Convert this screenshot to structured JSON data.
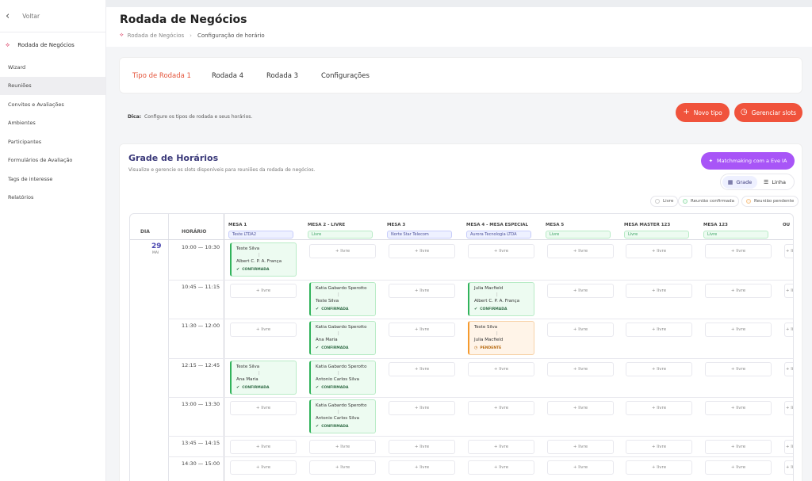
{
  "sidebar": {
    "back_label": "Voltar",
    "title": "Rodada de Negócios",
    "items": [
      {
        "label": "Wizard",
        "active": false
      },
      {
        "label": "Reuniões",
        "active": true
      },
      {
        "label": "Convites e Avaliações",
        "active": false
      },
      {
        "label": "Ambientes",
        "active": false
      },
      {
        "label": "Participantes",
        "active": false
      },
      {
        "label": "Formulários de Avaliação",
        "active": false
      },
      {
        "label": "Tags de interesse",
        "active": false
      },
      {
        "label": "Relatórios",
        "active": false
      }
    ]
  },
  "header": {
    "title": "Rodada de Negócios",
    "breadcrumb": [
      "Rodada de Negócios",
      "Configuração de horário"
    ]
  },
  "tabs": [
    {
      "label": "Tipo de Rodada 1",
      "active": true
    },
    {
      "label": "Rodada 4",
      "active": false
    },
    {
      "label": "Rodada 3",
      "active": false
    },
    {
      "label": "Configurações",
      "active": false
    }
  ],
  "tip": {
    "label": "Dica:",
    "text": "Configure os tipos de rodada e seus horários."
  },
  "actions": {
    "new_type": "Novo tipo",
    "manage_slots": "Gerenciar slots"
  },
  "grid": {
    "title": "Grade de Horários",
    "subtitle": "Visualize e gerencie os slots disponíveis para reuniões da rodada de negócios.",
    "ai_button": "Matchmaking com a Eve IA",
    "view_grid": "Grade",
    "view_list": "Linha",
    "legend": {
      "free": "Livre",
      "confirmed": "Reunião confirmada",
      "pending": "Reunião pendente"
    },
    "day_header": "DIA",
    "time_header": "HORÁRIO",
    "day": {
      "num": "29",
      "month": "MAI"
    },
    "free_label": "+ livre",
    "columns": [
      {
        "name": "MESA 1",
        "tag": "Teste LTDA2",
        "tag_style": "blue"
      },
      {
        "name": "MESA 2 - LIVRE",
        "tag": "Livre",
        "tag_style": "green"
      },
      {
        "name": "MESA 3",
        "tag": "Norte Star Telecom",
        "tag_style": "blue"
      },
      {
        "name": "MESA 4 - MESA ESPECIAL",
        "tag": "Aurora Tecnologia LTDA",
        "tag_style": "blue"
      },
      {
        "name": "MESA 5",
        "tag": "Livre",
        "tag_style": "green"
      },
      {
        "name": "MESA MASTER 123",
        "tag": "Livre",
        "tag_style": "green"
      },
      {
        "name": "MESA 123",
        "tag": "Livre",
        "tag_style": "green"
      },
      {
        "name": "OU",
        "tag": "",
        "tag_style": "green"
      }
    ],
    "rows": [
      {
        "time": "10:00 — 10:30",
        "cells": [
          {
            "a": "Teste Silva",
            "b": "Albert C. P. A. França",
            "status": "CONFIRMADA"
          },
          null,
          null,
          null,
          null,
          null,
          null,
          null
        ]
      },
      {
        "time": "10:45 — 11:15",
        "cells": [
          null,
          {
            "a": "Katia Gabardo Sperotto",
            "b": "Teste Silva",
            "status": "CONFIRMADA"
          },
          null,
          {
            "a": "Julia Macfield",
            "b": "Albert C. P. A. França",
            "status": "CONFIRMADA"
          },
          null,
          null,
          null,
          null
        ]
      },
      {
        "time": "11:30 — 12:00",
        "cells": [
          null,
          {
            "a": "Katia Gabardo Sperotto",
            "b": "Ana Maria",
            "status": "CONFIRMADA"
          },
          null,
          {
            "a": "Teste Silva",
            "b": "Julia Macfield",
            "status": "PENDENTE"
          },
          null,
          null,
          null,
          null
        ]
      },
      {
        "time": "12:15 — 12:45",
        "cells": [
          {
            "a": "Teste Silva",
            "b": "Ana Maria",
            "status": "CONFIRMADA"
          },
          {
            "a": "Katia Gabardo Sperotto",
            "b": "Antonio Carlos Silva",
            "status": "CONFIRMADA"
          },
          null,
          null,
          null,
          null,
          null,
          null
        ]
      },
      {
        "time": "13:00 — 13:30",
        "cells": [
          null,
          {
            "a": "Katia Gabardo Sperotto",
            "b": "Antonio Carlos Silva",
            "status": "CONFIRMADA"
          },
          null,
          null,
          null,
          null,
          null,
          null
        ]
      },
      {
        "time": "13:45 — 14:15",
        "cells": [
          null,
          null,
          null,
          null,
          null,
          null,
          null,
          null
        ]
      },
      {
        "time": "14:30 — 15:00",
        "cells": [
          null,
          null,
          null,
          null,
          null,
          null,
          null,
          null
        ]
      }
    ]
  },
  "colors": {
    "accent": "#f0533c",
    "brand": "#3b3a7a",
    "confirmed": "#31b35b",
    "pending": "#f59a2e",
    "ai": "#a855f7"
  }
}
